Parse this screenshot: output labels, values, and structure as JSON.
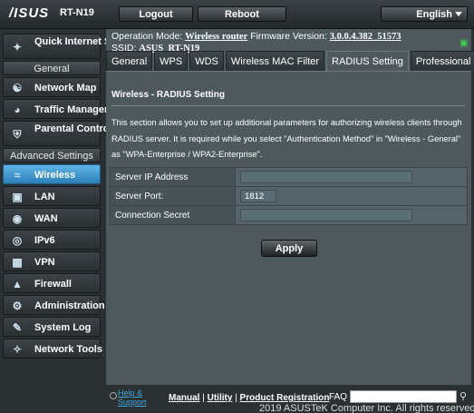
{
  "header": {
    "logo": "/ISUS",
    "model": "RT-N19",
    "logout_label": "Logout",
    "reboot_label": "Reboot",
    "language": "English"
  },
  "status": {
    "opmode_label": "Operation Mode:",
    "opmode_value": "Wireless router",
    "firmware_label": "Firmware Version:",
    "firmware_value": "3.0.0.4.382_51573",
    "ssid_label": "SSID:",
    "ssid_value": "ASUS_RT-N19"
  },
  "sidebar": {
    "quick_setup": "Quick Internet Setup",
    "general_header": "General",
    "general_items": [
      {
        "label": "Network Map",
        "icon": "network-map-icon"
      },
      {
        "label": "Traffic Manager",
        "icon": "traffic-manager-icon"
      },
      {
        "label": "Parental Controls",
        "icon": "parental-controls-icon"
      }
    ],
    "advanced_header": "Advanced Settings",
    "advanced_items": [
      {
        "label": "Wireless",
        "icon": "wireless-icon",
        "active": true
      },
      {
        "label": "LAN",
        "icon": "lan-icon"
      },
      {
        "label": "WAN",
        "icon": "wan-icon"
      },
      {
        "label": "IPv6",
        "icon": "ipv6-icon"
      },
      {
        "label": "VPN",
        "icon": "vpn-icon"
      },
      {
        "label": "Firewall",
        "icon": "firewall-icon"
      },
      {
        "label": "Administration",
        "icon": "administration-icon"
      },
      {
        "label": "System Log",
        "icon": "system-log-icon"
      },
      {
        "label": "Network Tools",
        "icon": "network-tools-icon"
      }
    ]
  },
  "tabs": [
    {
      "label": "General"
    },
    {
      "label": "WPS"
    },
    {
      "label": "WDS"
    },
    {
      "label": "Wireless MAC Filter"
    },
    {
      "label": "RADIUS Setting",
      "active": true
    },
    {
      "label": "Professional"
    }
  ],
  "page": {
    "title": "Wireless - RADIUS Setting",
    "description": "This section allows you to set up additional parameters for authorizing wireless clients through RADIUS server. It is required while you select \"Authentication Method\" in \"Wireless - General\" as \"WPA-Enterprise / WPA2-Enterprise\".",
    "fields": [
      {
        "label": "Server IP Address",
        "value": ""
      },
      {
        "label": "Server Port:",
        "value": "1812"
      },
      {
        "label": "Connection Secret",
        "value": ""
      }
    ],
    "apply_label": "Apply"
  },
  "footer": {
    "help_line1": "Help &",
    "help_line2": "Support",
    "manual": "Manual",
    "utility": "Utility",
    "product_registration": "Product Registration",
    "separator": " | ",
    "faq": "FAQ",
    "copyright": "2019 ASUSTeK Computer Inc. All rights reserved."
  }
}
